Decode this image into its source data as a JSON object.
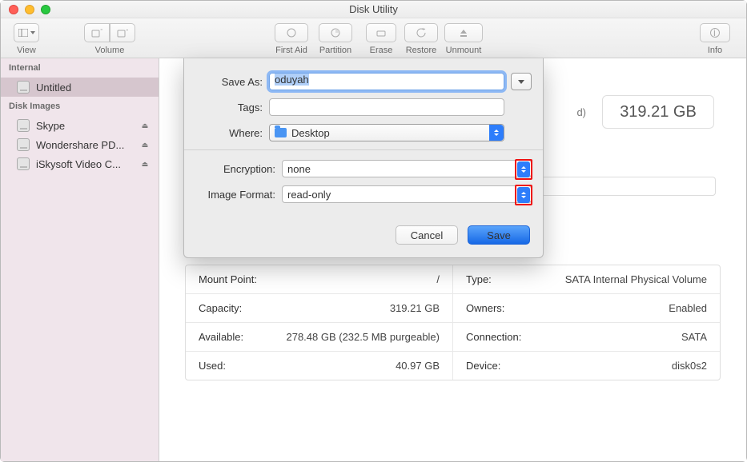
{
  "window": {
    "title": "Disk Utility"
  },
  "toolbar": {
    "view_label": "View",
    "volume_label": "Volume",
    "firstaid_label": "First Aid",
    "partition_label": "Partition",
    "erase_label": "Erase",
    "restore_label": "Restore",
    "unmount_label": "Unmount",
    "info_label": "Info"
  },
  "sidebar": {
    "sections": [
      {
        "title": "Internal",
        "items": [
          {
            "label": "Untitled",
            "selected": true
          }
        ]
      },
      {
        "title": "Disk Images",
        "items": [
          {
            "label": "Skype",
            "eject": true
          },
          {
            "label": "Wondershare PD...",
            "eject": true
          },
          {
            "label": "iSkysoft Video C...",
            "eject": true
          }
        ]
      }
    ]
  },
  "volume": {
    "truncated_suffix": "d)",
    "size_badge": "319.21 GB"
  },
  "sheet": {
    "save_as_label": "Save As:",
    "save_as_value": "oduyah",
    "tags_label": "Tags:",
    "where_label": "Where:",
    "where_value": "Desktop",
    "encryption_label": "Encryption:",
    "encryption_value": "none",
    "format_label": "Image Format:",
    "format_value": "read-only",
    "cancel": "Cancel",
    "save": "Save"
  },
  "info": {
    "rows": [
      {
        "l_key": "Mount Point:",
        "l_val": "/",
        "r_key": "Type:",
        "r_val": "SATA Internal Physical Volume"
      },
      {
        "l_key": "Capacity:",
        "l_val": "319.21 GB",
        "r_key": "Owners:",
        "r_val": "Enabled"
      },
      {
        "l_key": "Available:",
        "l_val": "278.48 GB (232.5 MB purgeable)",
        "r_key": "Connection:",
        "r_val": "SATA"
      },
      {
        "l_key": "Used:",
        "l_val": "40.97 GB",
        "r_key": "Device:",
        "r_val": "disk0s2"
      }
    ]
  }
}
